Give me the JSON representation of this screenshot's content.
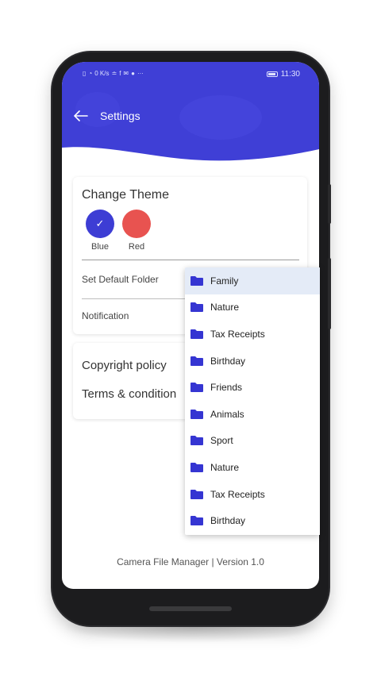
{
  "status_bar": {
    "left_icons": [
      "sim-icon",
      "wifi-icon",
      "network-speed",
      "usb-icon",
      "facebook-icon",
      "mail-icon",
      "app-icon",
      "more-dots"
    ],
    "speed_text": "0 K/s",
    "time": "11:30"
  },
  "header": {
    "title": "Settings",
    "color": "#3f3fd6"
  },
  "theme_card": {
    "title": "Change Theme",
    "options": [
      {
        "label": "Blue",
        "color": "#3d3dd4",
        "selected": true,
        "check": "✓"
      },
      {
        "label": "Red",
        "color": "#e85350",
        "selected": false
      }
    ],
    "set_default_folder": "Set Default Folder",
    "notification": "Notification"
  },
  "links_card": {
    "copyright": "Copyright policy",
    "terms": "Terms & condition"
  },
  "folder_dropdown": {
    "items": [
      {
        "label": "Family",
        "selected": true
      },
      {
        "label": "Nature",
        "selected": false
      },
      {
        "label": "Tax Receipts",
        "selected": false
      },
      {
        "label": "Birthday",
        "selected": false
      },
      {
        "label": "Friends",
        "selected": false
      },
      {
        "label": "Animals",
        "selected": false
      },
      {
        "label": "Sport",
        "selected": false
      },
      {
        "label": "Nature",
        "selected": false
      },
      {
        "label": "Tax Receipts",
        "selected": false
      },
      {
        "label": "Birthday",
        "selected": false
      }
    ],
    "icon_color": "#3535d2"
  },
  "footer": {
    "text": "Camera File Manager | Version 1.0"
  }
}
